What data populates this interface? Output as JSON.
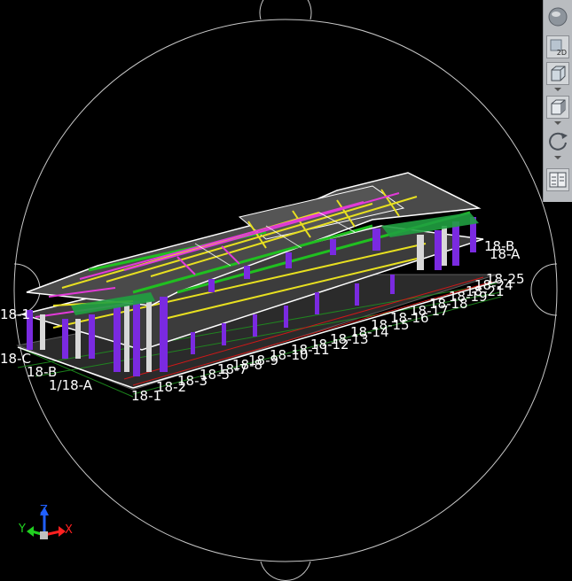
{
  "toolbar": {
    "items": [
      {
        "name": "view-cube-sphere-icon"
      },
      {
        "name": "2d-view-icon",
        "label": "2D"
      },
      {
        "name": "3d-box-view-icon"
      },
      {
        "name": "shaded-box-view-icon"
      },
      {
        "name": "orbit-rotate-icon"
      },
      {
        "name": "properties-panel-icon"
      }
    ]
  },
  "axes": {
    "x": "X",
    "y": "Y",
    "z": "Z"
  },
  "colors": {
    "background": "#000000",
    "x_axis": "#ff2020",
    "y_axis": "#20d020",
    "z_axis": "#2060ff"
  },
  "grid_labels": {
    "front": [
      "18-1",
      "18-2",
      "18-3",
      "18-4",
      "18-5",
      "18-6",
      "18-7",
      "18-8",
      "18-9",
      "18-10",
      "18-11",
      "18-12",
      "18-13",
      "18-14",
      "18-15",
      "18-16",
      "18-17",
      "18-18",
      "18-19",
      "18-20",
      "18-21",
      "18-22",
      "18-23",
      "18-24",
      "18-25"
    ],
    "right": [
      "18-A",
      "18-B",
      "18-C"
    ],
    "left": [
      "1/18-A",
      "18-B",
      "18-C"
    ]
  }
}
